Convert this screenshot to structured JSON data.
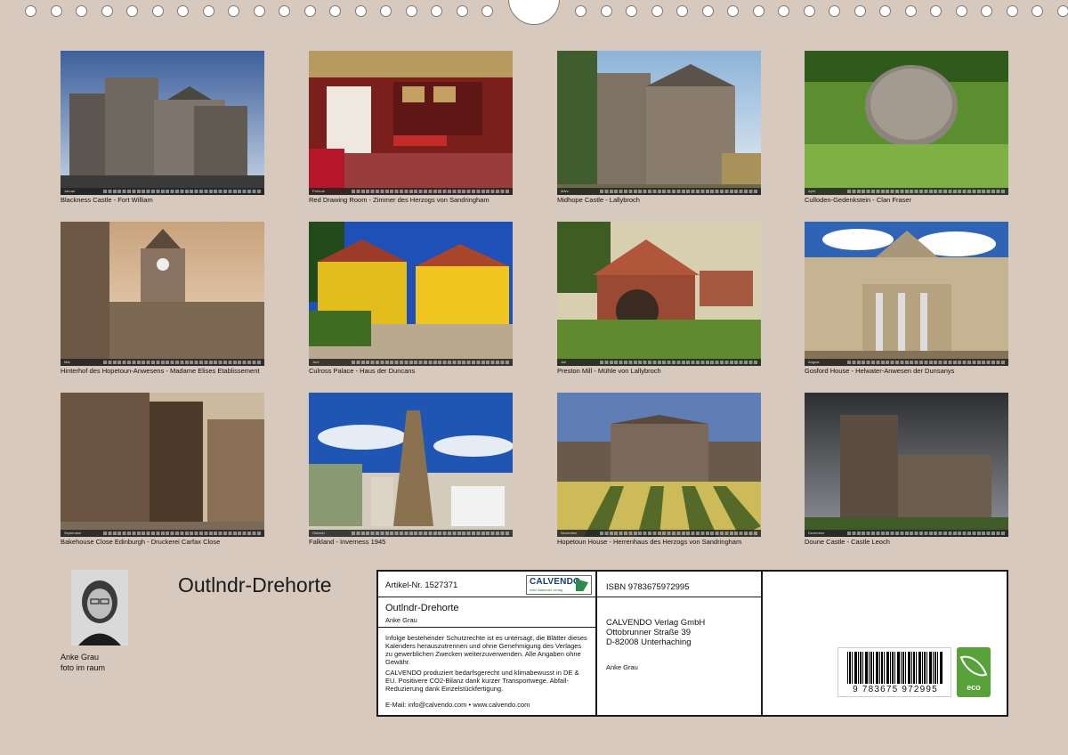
{
  "title": "Outlndr-Drehorte",
  "photos": [
    {
      "caption": "Blackness Castle - Fort William",
      "month": "Januar"
    },
    {
      "caption": "Red Drawing Room - Zimmer des Herzogs von Sandringham",
      "month": "Februar"
    },
    {
      "caption": "Midhope Castle - Lallybroch",
      "month": "März"
    },
    {
      "caption": "Culloden-Gedenkstein - Clan Fraser",
      "month": "April"
    },
    {
      "caption": "Hinterhof des Hopetoun-Anwesens - Madame Elises Etablissement",
      "month": "Mai"
    },
    {
      "caption": "Culross Palace - Haus der Duncans",
      "month": "Juni"
    },
    {
      "caption": "Preston Mill - Mühle von Lallybroch",
      "month": "Juli"
    },
    {
      "caption": "Gosford House - Helwater-Anwesen der Dunsanys",
      "month": "August"
    },
    {
      "caption": "Bakehouse Close Edinburgh -  Druckerei Carfax Close",
      "month": "September"
    },
    {
      "caption": "Falkland - Inverness 1945",
      "month": "Oktober"
    },
    {
      "caption": "Hopetoun House - Herrenhaus des Herzogs von Sandringham",
      "month": "November"
    },
    {
      "caption": "Doune Castle - Castle Leoch",
      "month": "Dezember"
    }
  ],
  "author": {
    "name": "Anke Grau",
    "sub": "foto im raum"
  },
  "info": {
    "article": "Artikel-Nr. 1527371",
    "logo": "CALVENDO",
    "logo_sub": "mein kalender verlag",
    "product_title": "Outlndr-Drehorte",
    "product_author": "Anke Grau",
    "legal1": "Infolge bestehender Schutzrechte ist es untersagt, die Blätter dieses Kalenders herauszutrennen und ohne Genehmigung des Verlages zu gewerblichen Zwecken weiterzuverwenden. Alle Angaben ohne Gewähr.",
    "legal2": "CALVENDO produziert bedarfsgerecht und klimabewusst in DE & EU. Positivere CO2-Bilanz dank kurzer Transportwege. Abfall-Reduzierung dank Einzelstückfertigung.",
    "contact": "E-Mail: info@calvendo.com • www.calvendo.com",
    "isbn": "ISBN 9783675972995",
    "publisher_lines": [
      "CALVENDO Verlag GmbH",
      "Ottobrunner Straße 39",
      "D-82008 Unterhaching"
    ],
    "credit": "Anke Grau",
    "barcode_number": "9 783675 972995",
    "eco_label": "eco"
  },
  "colors": {
    "background": "#d7c9be",
    "panel_border": "#1a1a1a",
    "eco_green": "#57a33a",
    "logo_blue": "#123b77"
  }
}
